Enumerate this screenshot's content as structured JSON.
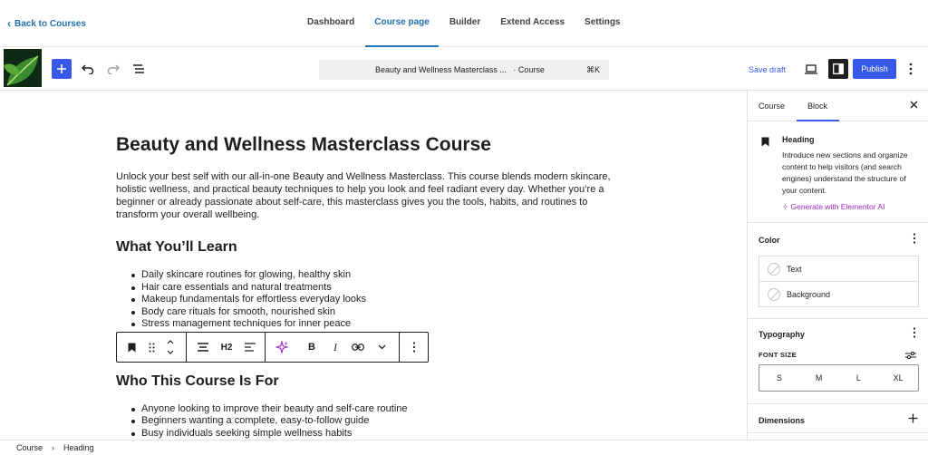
{
  "topnav": {
    "back_label": "Back to Courses",
    "tabs": [
      {
        "label": "Dashboard"
      },
      {
        "label": "Course page"
      },
      {
        "label": "Builder"
      },
      {
        "label": "Extend Access"
      },
      {
        "label": "Settings"
      }
    ],
    "active_tab": "Course page"
  },
  "toolbar": {
    "document_title": "Beauty and Wellness Masterclass ...",
    "document_type": "· Course",
    "shortcut": "⌘K",
    "save_draft": "Save draft",
    "publish": "Publish"
  },
  "content": {
    "title": "Beauty and Wellness Masterclass Course",
    "intro": "Unlock your best self with our all-in-one Beauty and Wellness Masterclass. This course blends modern skincare, holistic wellness, and practical beauty techniques to help you look and feel radiant every day. Whether you’re a beginner or already passionate about self-care, this masterclass gives you the tools, habits, and routines to transform your overall wellbeing.",
    "section1_heading": "What You’ll Learn",
    "section1_items": [
      "Daily skincare routines for glowing, healthy skin",
      "Hair care essentials and natural treatments",
      "Makeup fundamentals for effortless everyday looks",
      "Body care rituals for smooth, nourished skin",
      "Stress management techniques for inner peace"
    ],
    "section2_heading": "Who This Course Is For",
    "section2_items": [
      "Anyone looking to improve their beauty and self-care routine",
      "Beginners wanting a complete, easy-to-follow guide",
      "Busy individuals seeking simple wellness habits"
    ]
  },
  "block_toolbar": {
    "heading_level": "H2"
  },
  "sidebar": {
    "tab_course": "Course",
    "tab_block": "Block",
    "block_name": "Heading",
    "block_description": "Introduce new sections and organize content to help visitors (and search engines) understand the structure of your content.",
    "generate_ai": "Generate with Elementor AI",
    "color_title": "Color",
    "color_text": "Text",
    "color_background": "Background",
    "typography_title": "Typography",
    "font_size_label": "FONT SIZE",
    "font_sizes": [
      "S",
      "M",
      "L",
      "XL"
    ],
    "dimensions_title": "Dimensions"
  },
  "footer": {
    "crumb1": "Course",
    "separator": "›",
    "crumb2": "Heading"
  },
  "colors": {
    "accent": "#3858e9",
    "link": "#2271b1",
    "ai": "#9b2bbf"
  }
}
